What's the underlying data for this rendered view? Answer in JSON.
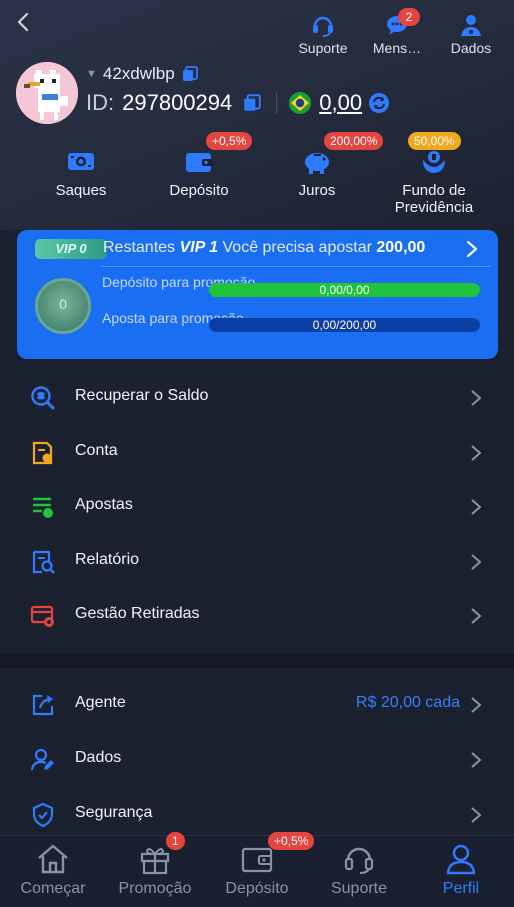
{
  "header": {
    "actions": [
      {
        "label": "Suporte",
        "icon": "headset-icon"
      },
      {
        "label": "Mens…",
        "icon": "chat-icon",
        "badge": "2"
      },
      {
        "label": "Dados",
        "icon": "user-data-icon"
      }
    ]
  },
  "profile": {
    "username": "42xdwlbp",
    "id_label": "ID:",
    "id_value": "297800294",
    "balance": "0,00"
  },
  "shortcuts": [
    {
      "label": "Saques",
      "icon": "withdraw-icon",
      "badge": ""
    },
    {
      "label": "Depósito",
      "icon": "wallet-icon",
      "badge": "+0,5%"
    },
    {
      "label": "Juros",
      "icon": "piggy-bank-icon",
      "badge": "200,00%"
    },
    {
      "label": "Fundo de Previdência",
      "icon": "fund-icon",
      "badge": "50,00%"
    }
  ],
  "vip": {
    "badge": "VIP 0",
    "text_prefix": "Restantes",
    "level": "VIP 1",
    "text_middle": "Você precisa apostar",
    "amount": "200,00",
    "medal_level": "0",
    "deposit_label": "Depósito para promoção",
    "deposit_progress": "0,00/0,00",
    "deposit_fraction": 1.0,
    "bet_label": "Aposta para promoção",
    "bet_progress": "0,00/200,00",
    "bet_fraction": 0.0
  },
  "menu": [
    {
      "label": "Recuperar o Saldo",
      "icon": "recover-balance-icon"
    },
    {
      "label": "Conta",
      "icon": "account-icon"
    },
    {
      "label": "Apostas",
      "icon": "bets-icon"
    },
    {
      "label": "Relatório",
      "icon": "report-icon"
    },
    {
      "label": "Gestão Retiradas",
      "icon": "withdraw-manage-icon"
    }
  ],
  "menu2": [
    {
      "label": "Agente",
      "icon": "agent-share-icon",
      "extra": "R$ 20,00 cada"
    },
    {
      "label": "Dados",
      "icon": "user-edit-icon",
      "extra": ""
    },
    {
      "label": "Segurança",
      "icon": "shield-icon",
      "extra": ""
    }
  ],
  "bottom_nav": [
    {
      "label": "Começar",
      "icon": "home-icon",
      "badge": ""
    },
    {
      "label": "Promoção",
      "icon": "gift-icon",
      "badge": "1"
    },
    {
      "label": "Depósito",
      "icon": "wallet-icon",
      "badge": "+0,5%"
    },
    {
      "label": "Suporte",
      "icon": "headset-icon",
      "badge": ""
    },
    {
      "label": "Perfil",
      "icon": "profile-icon",
      "badge": "",
      "active": true
    }
  ],
  "colors": {
    "accent": "#1a6ef2",
    "progress_fill": "#1fc439",
    "badge_red": "#e5453f",
    "badge_gold": "#f0a91e"
  }
}
